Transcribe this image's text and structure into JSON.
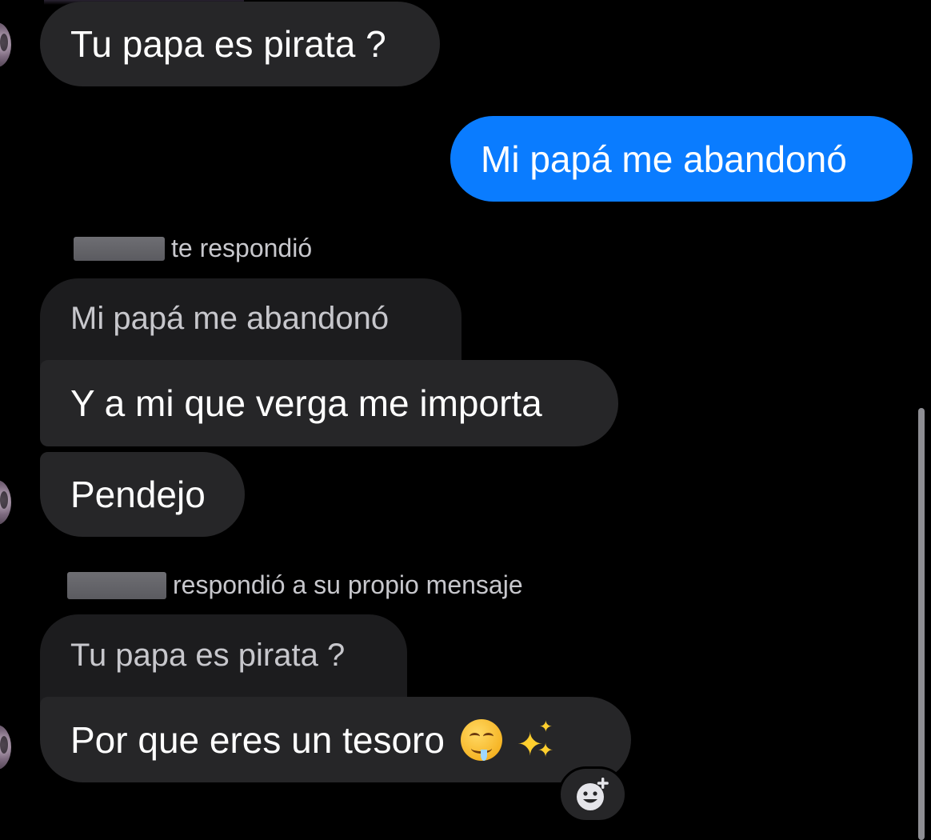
{
  "colors": {
    "background": "#000000",
    "incoming_bubble": "#262628",
    "outgoing_bubble": "#0a7cff",
    "quoted_bubble": "#1c1c1e",
    "meta_text": "#c7c7cc"
  },
  "messages": [
    {
      "text": "Tu papa es pirata ?",
      "direction": "incoming"
    },
    {
      "text": "Mi papá me abandonó",
      "direction": "outgoing"
    }
  ],
  "reply_1": {
    "note": "te respondió",
    "quoted": "Mi papá me abandonó",
    "bubbles": [
      "Y a mi que verga me importa",
      "Pendejo"
    ]
  },
  "reply_2": {
    "note": "respondió a su propio mensaje",
    "quoted": "Tu papa es pirata ?",
    "bubble_text": "Por que eres un tesoro",
    "emojis": [
      "drooling-face-emoji",
      "sparkles-emoji"
    ]
  },
  "icons": {
    "add_reaction": "smiley-plus-icon"
  }
}
